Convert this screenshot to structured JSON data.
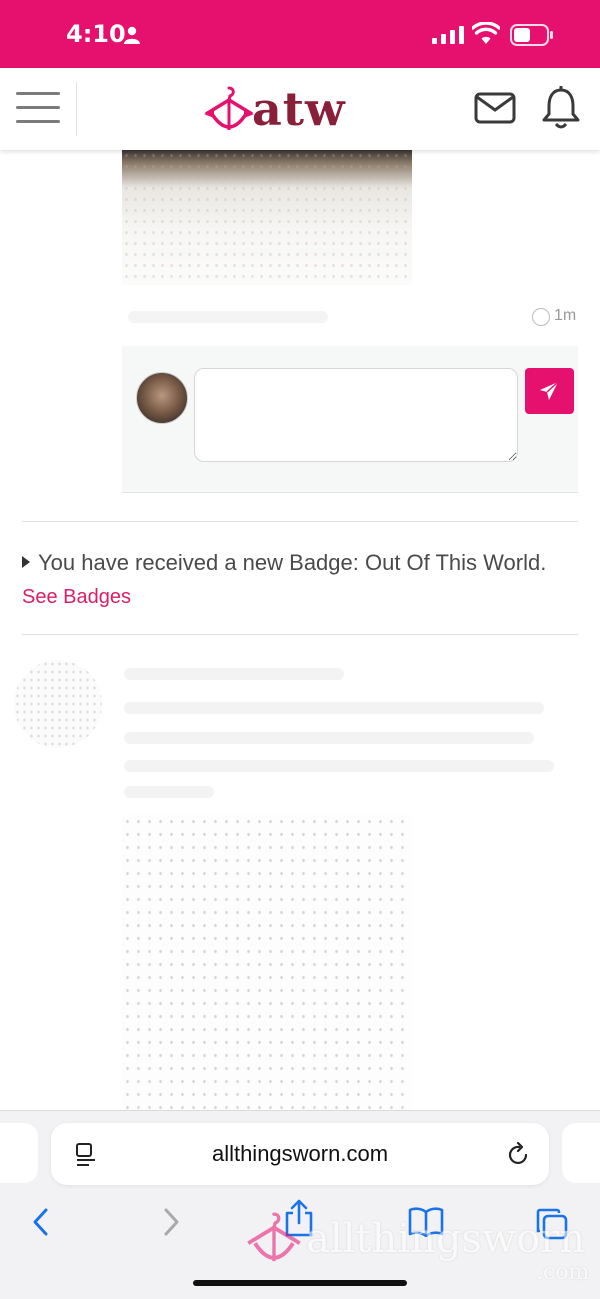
{
  "status_bar": {
    "time": "4:10"
  },
  "header": {
    "logo_text": "atw",
    "accent": "#e6106e",
    "brand_color": "#8a1f3a"
  },
  "post": {
    "time_ago": "1m"
  },
  "comment": {
    "input_value": "",
    "send_icon": "paper-plane-icon"
  },
  "notification": {
    "text": "You have received a new Badge: Out Of This World.",
    "link_label": "See Badges"
  },
  "browser": {
    "url": "allthingsworn.com"
  },
  "watermark": {
    "text": "allthingsworn",
    "suffix": ".com"
  }
}
